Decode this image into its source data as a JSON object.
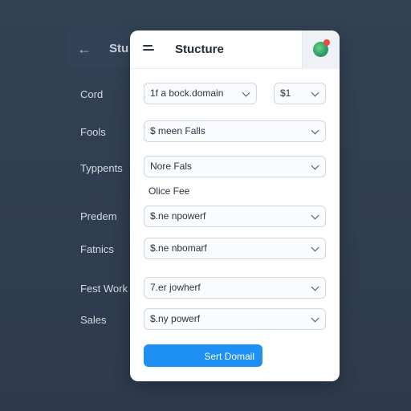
{
  "background_panel": {
    "back_icon": "arrow-left-icon",
    "title": "Stu"
  },
  "card": {
    "title": "Stucture",
    "menu_icon": "hamburger-menu-icon",
    "app_icon": "globe-app-icon"
  },
  "left_labels": [
    "Cord",
    "Fools",
    "Typpents",
    "Predem",
    "Fatnics",
    "Fest Work",
    "Sales"
  ],
  "selects": [
    {
      "value": "1f a bock.domain"
    },
    {
      "value": "$1"
    },
    {
      "value": "$ meen Falls"
    },
    {
      "value": "Nore Fals"
    },
    {
      "value": "$.ne npowerf"
    },
    {
      "value": "$.ne nbomarf"
    },
    {
      "value": "7.er jowherf"
    },
    {
      "value": "$.ny powerf"
    }
  ],
  "static_label": "Olice Fee",
  "primary_button": "Sert Domail",
  "colors": {
    "background": "#2f3d4f",
    "card": "#ffffff",
    "accent": "#1d8ff5",
    "text": "#2b3440"
  }
}
